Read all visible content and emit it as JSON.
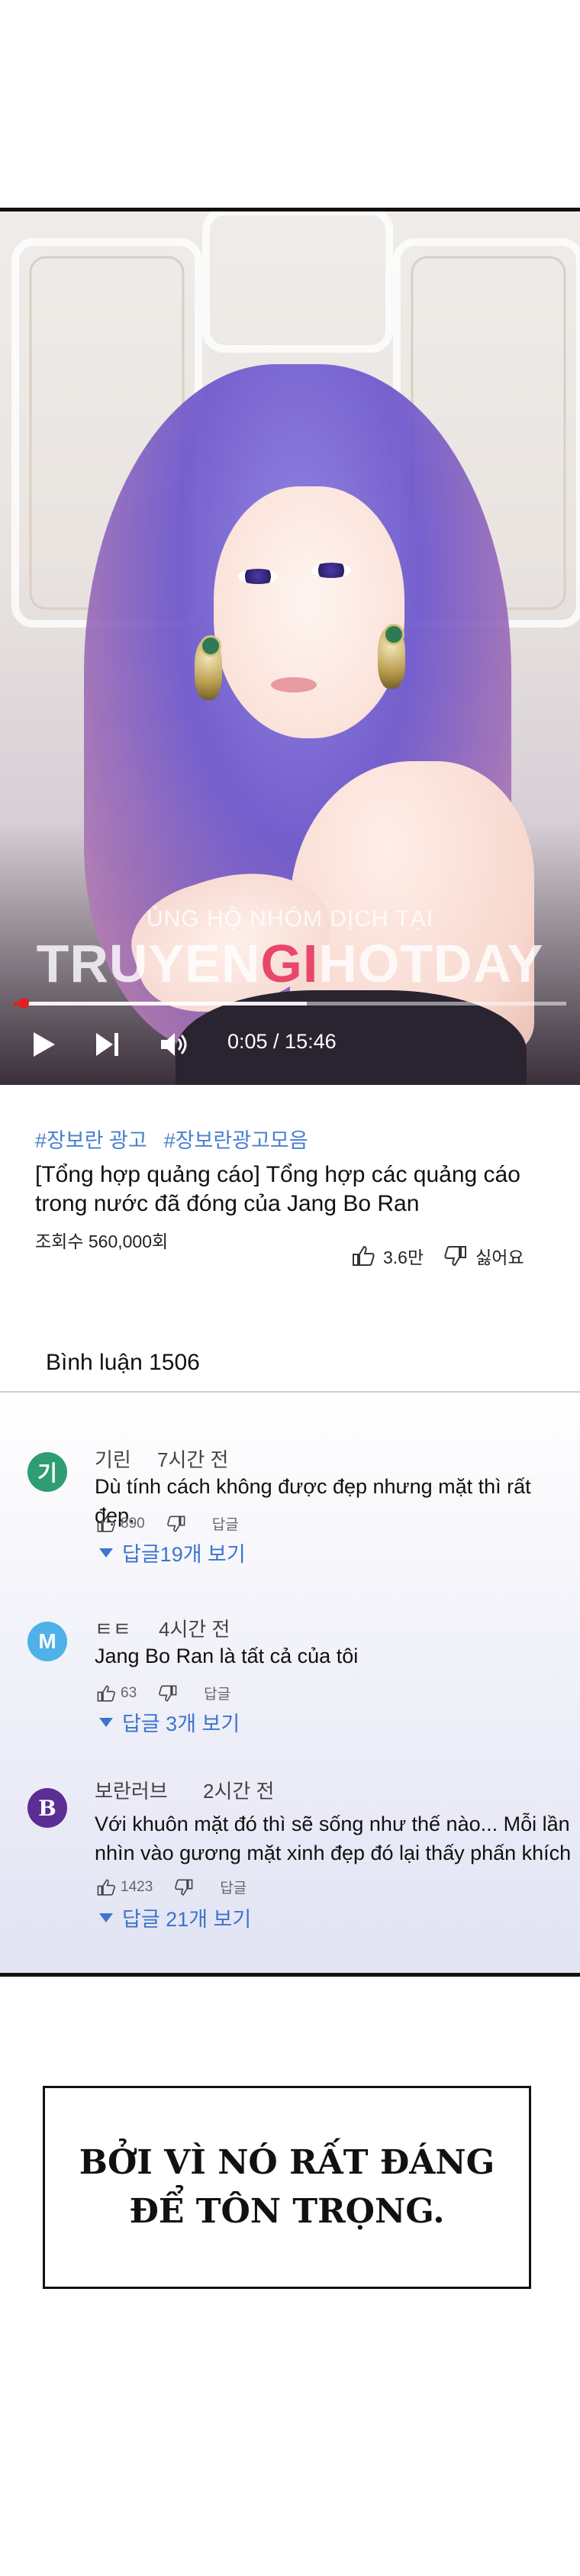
{
  "player": {
    "watermark_line1": "ỦNG HỘ NHÓM DỊCH TẠI",
    "watermark_pre": "TRUYEN",
    "watermark_mid": "GI",
    "watermark_post": "HOTDAY",
    "time": "0:05 / 15:46",
    "progress_fraction": 0.006,
    "buffered_fraction": 0.53,
    "icons": [
      "play-icon",
      "next-icon",
      "volume-icon"
    ]
  },
  "video": {
    "tags": [
      "#장보란 광고",
      "#장보란광고모음"
    ],
    "title": "[Tổng hợp quảng cáo] Tổng hợp các quảng cáo trong nước đã đóng của Jang Bo Ran",
    "views": "조회수 560,000회",
    "likes": "3.6만",
    "dislike_label": "싫어요"
  },
  "comments_header": {
    "count_label": "Bình luận 1506"
  },
  "comments": [
    {
      "avatar_letter": "기",
      "avatar_color": "#2e9d73",
      "user": "기린",
      "time": "7시간 전",
      "text": "Dù tính cách không được đẹp nhưng mặt thì rất đẹp.",
      "likes": "890",
      "reply_label": "답글",
      "replies": "답글19개 보기"
    },
    {
      "avatar_letter": "M",
      "avatar_color": "#4fb0ea",
      "user": "ㅌㅌ",
      "time": "4시간 전",
      "text": "Jang Bo Ran là tất cả của tôi",
      "likes": "63",
      "reply_label": "답글",
      "replies": "답글 3개 보기"
    },
    {
      "avatar_letter": "B",
      "avatar_color": "#5b2e94",
      "user": "보란러브",
      "time": "2시간 전",
      "text": "Với khuôn mặt đó thì sẽ sống như thế nào... Mỗi lần nhìn vào gương mặt xinh đẹp đó lại thấy phấn khích",
      "likes": "1423",
      "reply_label": "답글",
      "replies": "답글 21개 보기"
    }
  ],
  "caption": {
    "line1": "BỞI VÌ NÓ RẤT ĐÁNG",
    "line2": "ĐỂ TÔN TRỌNG."
  },
  "colors": {
    "link_blue": "#3d74cc",
    "tag_blue": "#4a7fd0",
    "progress_red": "#e02020"
  }
}
